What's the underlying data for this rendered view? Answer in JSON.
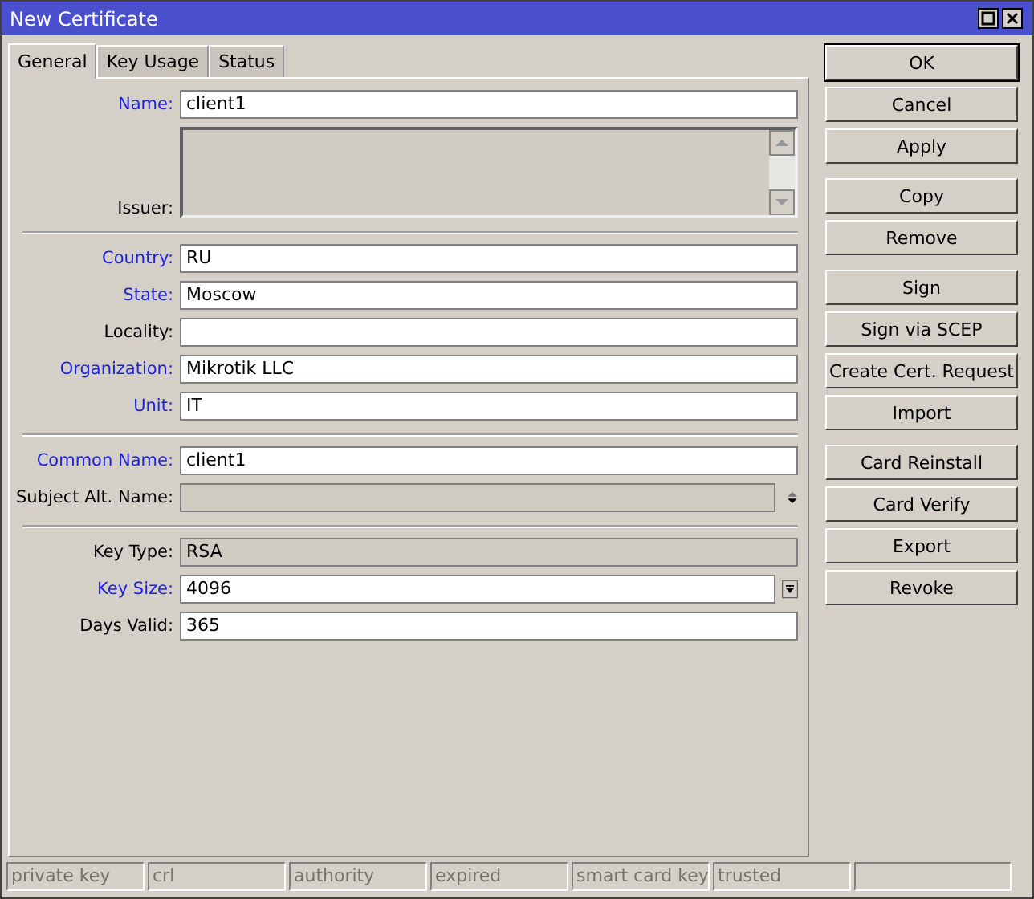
{
  "window": {
    "title": "New Certificate"
  },
  "tabs": [
    {
      "label": "General",
      "selected": true
    },
    {
      "label": "Key Usage",
      "selected": false
    },
    {
      "label": "Status",
      "selected": false
    }
  ],
  "sections": [
    {
      "fields": [
        {
          "label": "Name:",
          "kind": "text",
          "value": "client1",
          "highlighted": true,
          "disabled": false
        },
        {
          "label": "Issuer:",
          "kind": "textarea",
          "highlighted": false,
          "disabled": true
        }
      ]
    },
    {
      "fields": [
        {
          "label": "Country:",
          "kind": "text",
          "value": "RU",
          "highlighted": true,
          "disabled": false
        },
        {
          "label": "State:",
          "kind": "text",
          "value": "Moscow",
          "highlighted": true,
          "disabled": false
        },
        {
          "label": "Locality:",
          "kind": "text",
          "highlighted": false,
          "disabled": false
        },
        {
          "label": "Organization:",
          "kind": "text",
          "value": "Mikrotik LLC",
          "highlighted": true,
          "disabled": false
        },
        {
          "label": "Unit:",
          "kind": "text",
          "value": "IT",
          "highlighted": true,
          "disabled": false
        }
      ]
    },
    {
      "fields": [
        {
          "label": "Common Name:",
          "kind": "text",
          "value": "client1",
          "highlighted": true,
          "disabled": false
        },
        {
          "label": "Subject Alt. Name:",
          "kind": "multi",
          "highlighted": false,
          "disabled": true
        }
      ]
    },
    {
      "fields": [
        {
          "label": "Key Type:",
          "kind": "text",
          "value": "RSA",
          "highlighted": false,
          "disabled": true
        },
        {
          "label": "Key Size:",
          "kind": "dropdown",
          "value": "4096",
          "highlighted": true,
          "disabled": false
        },
        {
          "label": "Days Valid:",
          "kind": "text",
          "value": "365",
          "highlighted": false,
          "disabled": false
        }
      ]
    }
  ],
  "button_groups": [
    {
      "buttons": [
        {
          "label": "OK",
          "default": true
        },
        {
          "label": "Cancel",
          "default": false
        },
        {
          "label": "Apply",
          "default": false
        }
      ]
    },
    {
      "buttons": [
        {
          "label": "Copy",
          "default": false
        },
        {
          "label": "Remove",
          "default": false
        }
      ]
    },
    {
      "buttons": [
        {
          "label": "Sign",
          "default": false
        },
        {
          "label": "Sign via SCEP",
          "default": false
        },
        {
          "label": "Create Cert. Request",
          "default": false
        },
        {
          "label": "Import",
          "default": false
        }
      ]
    },
    {
      "buttons": [
        {
          "label": "Card Reinstall",
          "default": false
        },
        {
          "label": "Card Verify",
          "default": false
        },
        {
          "label": "Export",
          "default": false
        },
        {
          "label": "Revoke",
          "default": false
        }
      ]
    }
  ],
  "status_bar": [
    {
      "label": "private key",
      "on": false
    },
    {
      "label": "crl",
      "on": false
    },
    {
      "label": "authority",
      "on": false
    },
    {
      "label": "expired",
      "on": false
    },
    {
      "label": "smart card key",
      "on": false
    },
    {
      "label": "trusted",
      "on": false
    }
  ]
}
